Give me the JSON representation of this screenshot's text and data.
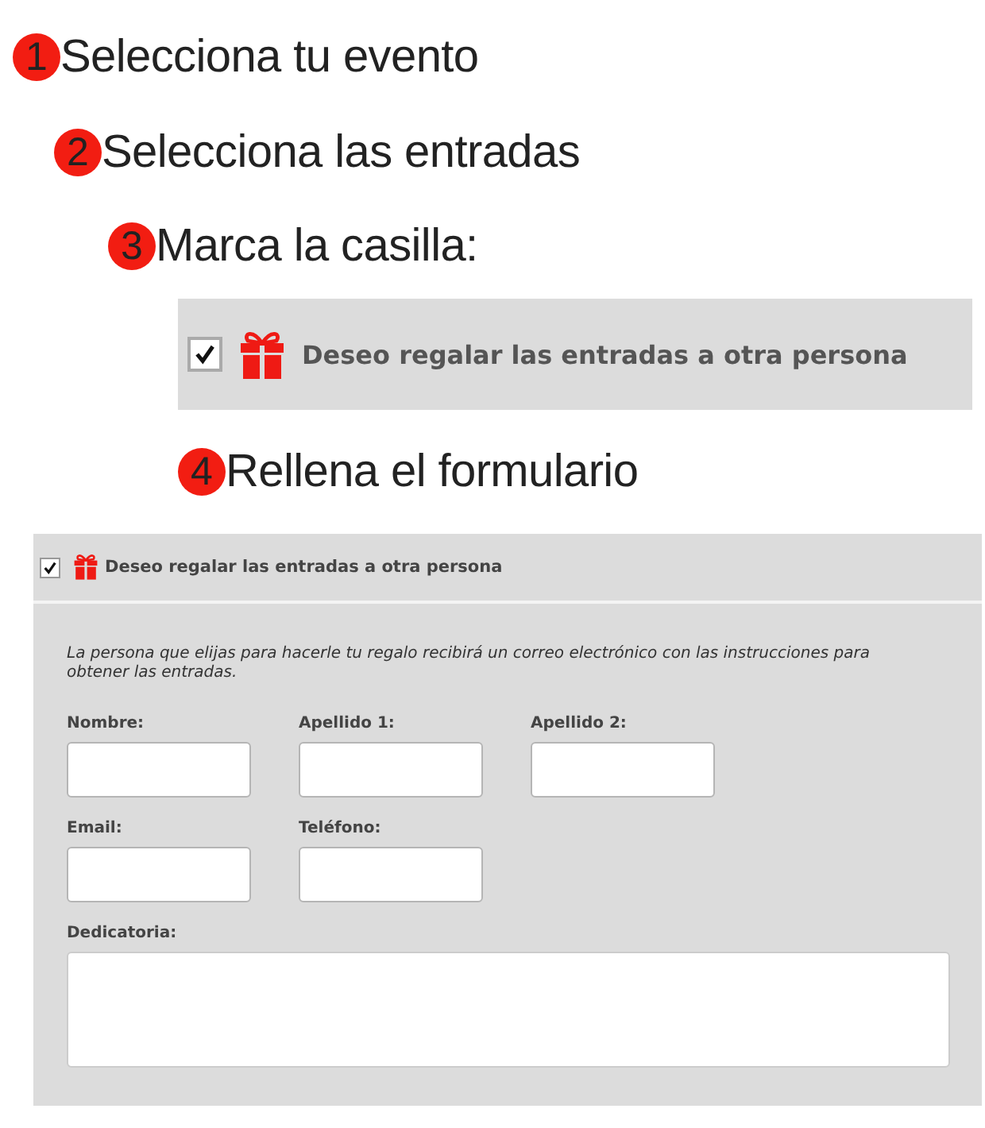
{
  "steps": [
    {
      "number": "1",
      "text": "Selecciona tu evento"
    },
    {
      "number": "2",
      "text": "Selecciona las entradas"
    },
    {
      "number": "3",
      "text": "Marca la casilla:"
    },
    {
      "number": "4",
      "text": "Rellena el formulario"
    }
  ],
  "example_option": {
    "label": "Deseo regalar las entradas a otra persona",
    "checked": true
  },
  "form": {
    "option": {
      "label": "Deseo regalar las entradas a otra persona",
      "checked": true
    },
    "description": "La persona que elijas para hacerle tu regalo recibirá un correo electrónico con las instrucciones para obtener las entradas.",
    "field_rows": [
      [
        {
          "label": "Nombre:",
          "kind": "input"
        },
        {
          "label": "Apellido 1:",
          "kind": "input"
        },
        {
          "label": "Apellido 2:",
          "kind": "input"
        }
      ],
      [
        {
          "label": "Email:",
          "kind": "input"
        },
        {
          "label": "Teléfono:",
          "kind": "input"
        }
      ],
      [
        {
          "label": "Dedicatoria:",
          "kind": "textarea"
        }
      ]
    ]
  }
}
